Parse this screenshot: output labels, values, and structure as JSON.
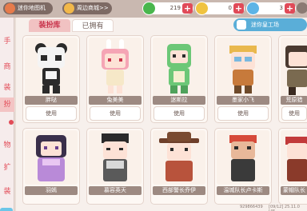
{
  "topbar": {
    "map_label": "迷你地图机>>",
    "weekly_label": "周边商城>>",
    "coins": "219",
    "beans": "0",
    "stars": "3"
  },
  "colors": {
    "accent": "#e24b57",
    "secondary": "#5aaed8"
  },
  "sidebar": {
    "items": [
      {
        "label": "手"
      },
      {
        "label": "商"
      },
      {
        "label": "装"
      },
      {
        "label": "扮"
      },
      {
        "label": "物"
      },
      {
        "label": "扩"
      },
      {
        "label": "装"
      }
    ]
  },
  "tabs": [
    {
      "label": "装扮库",
      "active": true
    },
    {
      "label": "已拥有",
      "active": false
    }
  ],
  "workshop_label": "迷你皇工场",
  "characters": [
    {
      "name": "胖哒",
      "button": "使用"
    },
    {
      "name": "兔美美",
      "button": "使用"
    },
    {
      "name": "迷斯拉",
      "button": "使用"
    },
    {
      "name": "墨家小飞",
      "button": "使用"
    },
    {
      "name": "荒原猎",
      "button": "使用"
    },
    {
      "name": "羽嫣",
      "button": "使用"
    },
    {
      "name": "慕容英天",
      "button": "使用"
    },
    {
      "name": "西部警长乔伊",
      "button": "使用"
    },
    {
      "name": "温城队长卢卡斯",
      "button": "使用"
    },
    {
      "name": "蒙帽队长",
      "button": "使用"
    }
  ],
  "footer": {
    "uid": "929866439",
    "version": "[09/12] 25.11.0  [45"
  }
}
